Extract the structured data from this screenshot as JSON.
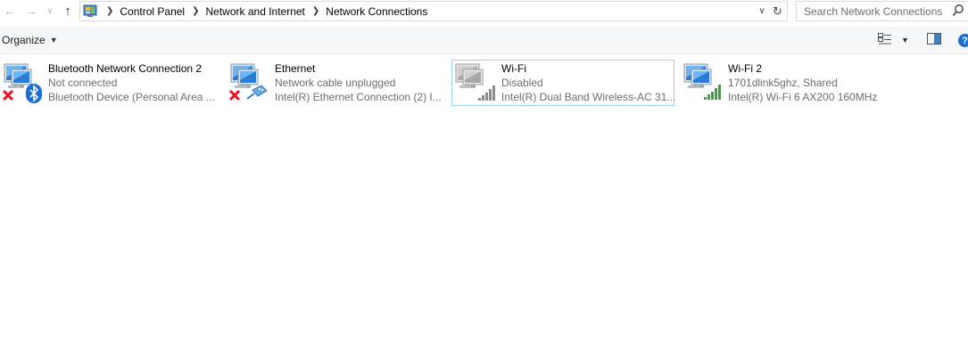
{
  "nav": {
    "back_icon": "back-arrow-icon",
    "forward_icon": "forward-arrow-icon",
    "recent_icon": "recent-locations-chevron-icon",
    "up_icon": "up-arrow-icon"
  },
  "address": {
    "icon": "control-panel-icon",
    "breadcrumbs": [
      "Control Panel",
      "Network and Internet",
      "Network Connections"
    ]
  },
  "search": {
    "placeholder": "Search Network Connections"
  },
  "toolbar": {
    "organize_label": "Organize"
  },
  "connections": [
    {
      "name": "Bluetooth Network Connection 2",
      "status": "Not connected",
      "device": "Bluetooth Device (Personal Area ...",
      "icon": "bluetooth-network-icon",
      "overlay": "red-x-icon",
      "selected": false
    },
    {
      "name": "Ethernet",
      "status": "Network cable unplugged",
      "device": "Intel(R) Ethernet Connection (2) I...",
      "icon": "ethernet-network-icon",
      "overlay": "red-x-icon",
      "selected": false
    },
    {
      "name": "Wi-Fi",
      "status": "Disabled",
      "device": "Intel(R) Dual Band Wireless-AC 31...",
      "icon": "wifi-disabled-icon",
      "overlay": "gray-signal-bars-icon",
      "selected": true
    },
    {
      "name": "Wi-Fi 2",
      "status": "1701dlink5ghz, Shared",
      "device": "Intel(R) Wi-Fi 6 AX200 160MHz",
      "icon": "wifi-connected-icon",
      "overlay": "green-signal-bars-icon",
      "selected": false
    }
  ],
  "colors": {
    "selection_border": "#99d1ff",
    "secondary_text": "#6d6d6d",
    "error_red": "#e81123",
    "signal_green": "#3aa43a",
    "help_blue": "#1b6fd0"
  }
}
